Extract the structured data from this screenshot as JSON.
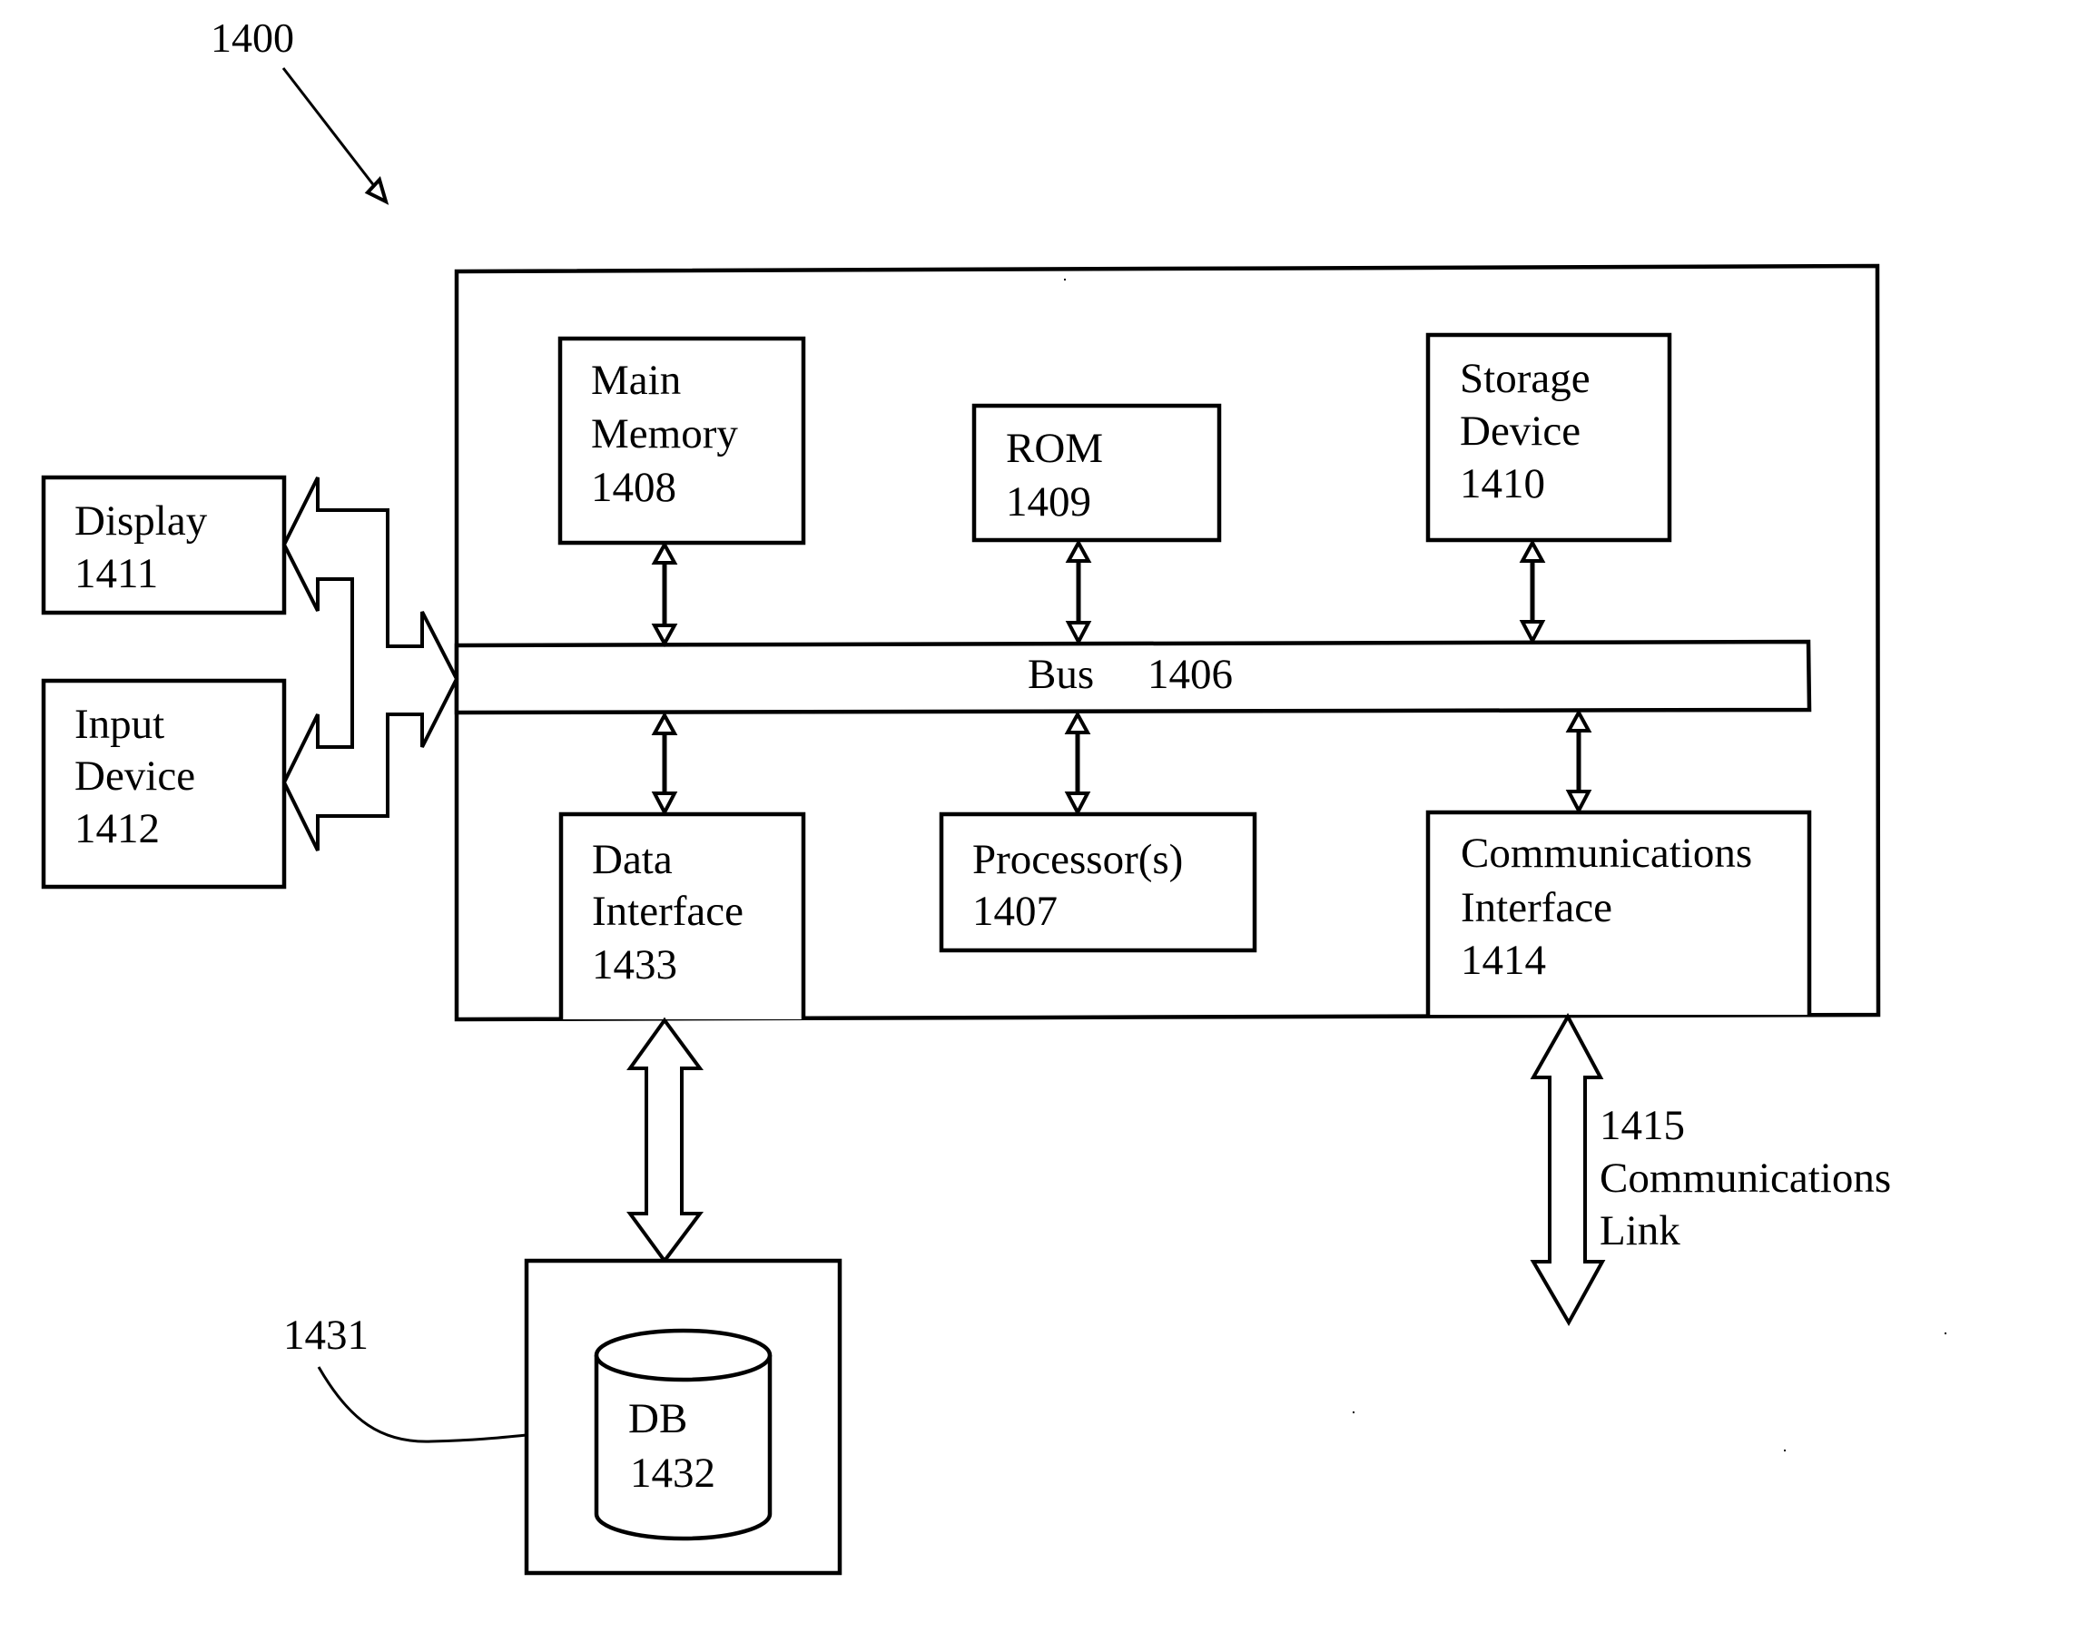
{
  "figure": {
    "reference": "1400"
  },
  "system": {
    "main_memory": {
      "lines": [
        "Main",
        "Memory",
        "1408"
      ]
    },
    "rom": {
      "lines": [
        "ROM",
        "1409"
      ]
    },
    "storage_device": {
      "lines": [
        "Storage",
        "Device",
        "1410"
      ]
    },
    "bus": {
      "label": "Bus",
      "number": "1406"
    },
    "data_interface": {
      "lines": [
        "Data",
        "Interface",
        "1433"
      ]
    },
    "processor": {
      "lines": [
        "Processor(s)",
        "1407"
      ]
    },
    "communications_interface": {
      "lines": [
        "Communications",
        "Interface",
        "1414"
      ]
    }
  },
  "peripherals": {
    "display": {
      "lines": [
        "Display",
        "1411"
      ]
    },
    "input_device": {
      "lines": [
        "Input",
        "Device",
        "1412"
      ]
    }
  },
  "communications_link": {
    "lines": [
      "1415",
      "Communications",
      "Link"
    ]
  },
  "database": {
    "container_reference": "1431",
    "lines": [
      "DB",
      "1432"
    ]
  }
}
